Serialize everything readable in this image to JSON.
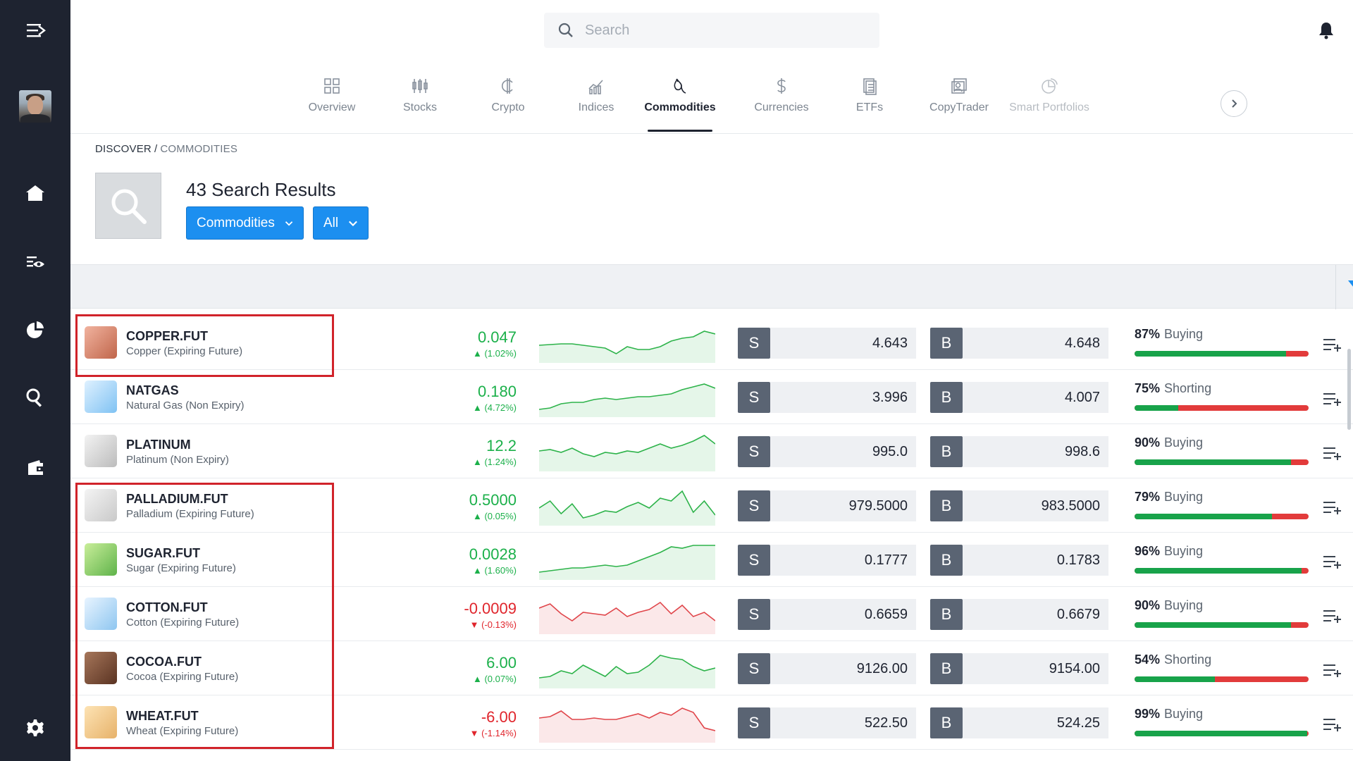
{
  "search": {
    "placeholder": "Search"
  },
  "tabs": [
    {
      "label": "Overview",
      "icon": "overview-icon"
    },
    {
      "label": "Stocks",
      "icon": "stocks-icon"
    },
    {
      "label": "Crypto",
      "icon": "crypto-icon"
    },
    {
      "label": "Indices",
      "icon": "indices-icon"
    },
    {
      "label": "Commodities",
      "icon": "commodities-icon",
      "active": true
    },
    {
      "label": "Currencies",
      "icon": "currencies-icon"
    },
    {
      "label": "ETFs",
      "icon": "etfs-icon"
    },
    {
      "label": "CopyTrader",
      "icon": "copytrader-icon"
    },
    {
      "label": "Smart Portfolios",
      "icon": "smart-portfolios-icon"
    }
  ],
  "breadcrumb": {
    "root": "DISCOVER",
    "separator": "/",
    "current": "COMMODITIES"
  },
  "results": {
    "title": "43 Search Results",
    "filter_type": "Commodities",
    "filter_scope": "All"
  },
  "colors": {
    "accent": "#1c8ff0",
    "positive": "#1bb04a",
    "negative": "#e0252c",
    "sidebar": "#1e2330",
    "highlight": "#d1232a"
  },
  "instruments": [
    {
      "symbol": "COPPER.FUT",
      "name": "Copper (Expiring Future)",
      "change": "0.047",
      "change_pct": "(1.02%)",
      "direction": "up",
      "sell_label": "S",
      "buy_label": "B",
      "sell": "4.643",
      "buy": "4.648",
      "sentiment_pct": "87%",
      "sentiment_label": "Buying",
      "buying_share": 87
    },
    {
      "symbol": "NATGAS",
      "name": "Natural Gas (Non Expiry)",
      "change": "0.180",
      "change_pct": "(4.72%)",
      "direction": "up",
      "sell_label": "S",
      "buy_label": "B",
      "sell": "3.996",
      "buy": "4.007",
      "sentiment_pct": "75%",
      "sentiment_label": "Shorting",
      "buying_share": 25
    },
    {
      "symbol": "PLATINUM",
      "name": "Platinum (Non Expiry)",
      "change": "12.2",
      "change_pct": "(1.24%)",
      "direction": "up",
      "sell_label": "S",
      "buy_label": "B",
      "sell": "995.0",
      "buy": "998.6",
      "sentiment_pct": "90%",
      "sentiment_label": "Buying",
      "buying_share": 90
    },
    {
      "symbol": "PALLADIUM.FUT",
      "name": "Palladium (Expiring Future)",
      "change": "0.5000",
      "change_pct": "(0.05%)",
      "direction": "up",
      "sell_label": "S",
      "buy_label": "B",
      "sell": "979.5000",
      "buy": "983.5000",
      "sentiment_pct": "79%",
      "sentiment_label": "Buying",
      "buying_share": 79
    },
    {
      "symbol": "SUGAR.FUT",
      "name": "Sugar (Expiring Future)",
      "change": "0.0028",
      "change_pct": "(1.60%)",
      "direction": "up",
      "sell_label": "S",
      "buy_label": "B",
      "sell": "0.1777",
      "buy": "0.1783",
      "sentiment_pct": "96%",
      "sentiment_label": "Buying",
      "buying_share": 96
    },
    {
      "symbol": "COTTON.FUT",
      "name": "Cotton (Expiring Future)",
      "change": "-0.0009",
      "change_pct": "(-0.13%)",
      "direction": "down",
      "sell_label": "S",
      "buy_label": "B",
      "sell": "0.6659",
      "buy": "0.6679",
      "sentiment_pct": "90%",
      "sentiment_label": "Buying",
      "buying_share": 90
    },
    {
      "symbol": "COCOA.FUT",
      "name": "Cocoa (Expiring Future)",
      "change": "6.00",
      "change_pct": "(0.07%)",
      "direction": "up",
      "sell_label": "S",
      "buy_label": "B",
      "sell": "9126.00",
      "buy": "9154.00",
      "sentiment_pct": "54%",
      "sentiment_label": "Shorting",
      "buying_share": 46
    },
    {
      "symbol": "WHEAT.FUT",
      "name": "Wheat (Expiring Future)",
      "change": "-6.00",
      "change_pct": "(-1.14%)",
      "direction": "down",
      "sell_label": "S",
      "buy_label": "B",
      "sell": "522.50",
      "buy": "524.25",
      "sentiment_pct": "99%",
      "sentiment_label": "Buying",
      "buying_share": 99
    }
  ]
}
